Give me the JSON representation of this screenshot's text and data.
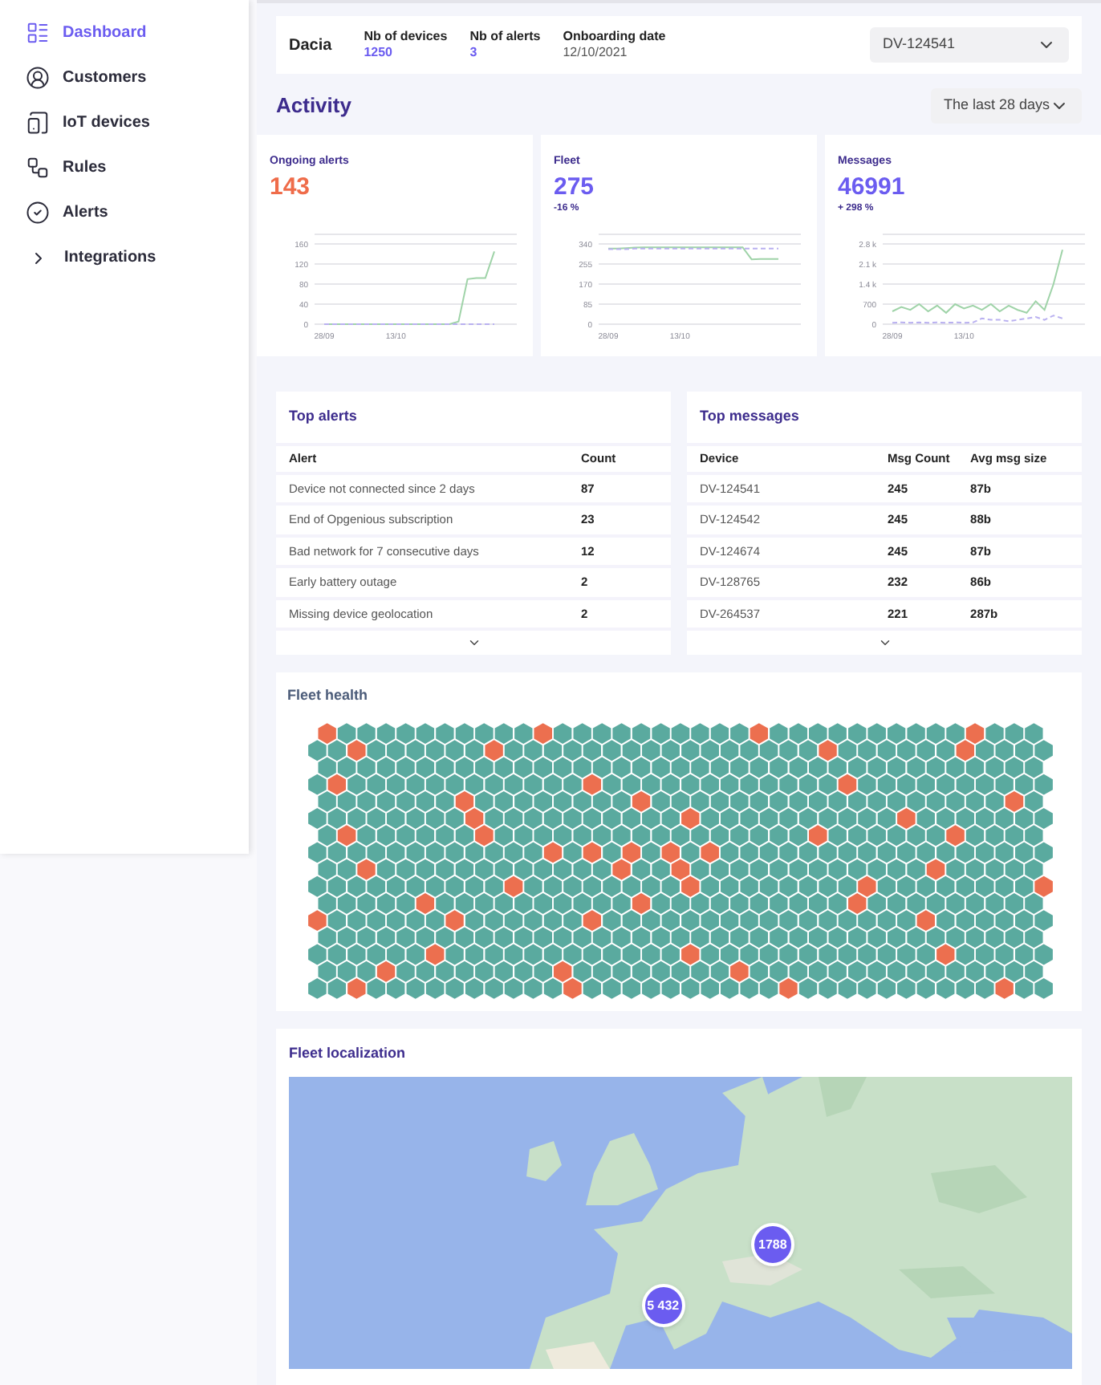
{
  "sidebar": {
    "items": [
      {
        "label": "Dashboard",
        "kind": "link",
        "selected": true
      },
      {
        "label": "Customers",
        "kind": "link",
        "selected": false
      },
      {
        "label": "IoT devices",
        "kind": "link",
        "selected": false
      },
      {
        "label": "Rules",
        "kind": "link",
        "selected": false
      },
      {
        "label": "Alerts",
        "kind": "link",
        "selected": false
      },
      {
        "label": "Integrations",
        "kind": "group",
        "selected": false,
        "expanded": false
      }
    ]
  },
  "customer": {
    "name": "Dacia",
    "facts": [
      {
        "label": "Nb of devices",
        "value": "1250",
        "kind": "highlight"
      },
      {
        "label": "Nb of alerts",
        "value": "3",
        "kind": "highlight"
      },
      {
        "label": "Onboarding date",
        "value": "12/10/2021",
        "kind": "plain"
      }
    ],
    "device_select": {
      "value": "DV-124541"
    }
  },
  "activity": {
    "title": "Activity",
    "period_select": {
      "value": "The last 28 days"
    },
    "cards": [
      {
        "title": "Ongoing alerts",
        "value": "143",
        "color": "#ef6c4a",
        "chart_data": {
          "type": "line",
          "categories": [
            "28/09",
            null,
            null,
            null,
            null,
            null,
            null,
            null,
            "13/10",
            null,
            null,
            null,
            null,
            null,
            null,
            null,
            null,
            null,
            null,
            null
          ],
          "yticks": [
            0,
            40,
            80,
            120,
            160
          ],
          "ylim": [
            0,
            160
          ],
          "grid": true,
          "series": [
            {
              "color": "#9fd3a8",
              "line_style": "solid",
              "values": [
                0,
                0,
                0,
                0,
                0,
                0,
                0,
                0,
                0,
                0,
                0,
                0,
                0,
                0,
                0,
                5,
                90,
                92,
                92,
                145
              ]
            },
            {
              "color": "#b9b0f0",
              "line_style": "dashed",
              "values": [
                0,
                0,
                0,
                0,
                0,
                0,
                0,
                0,
                0,
                0,
                0,
                0,
                0,
                0,
                0,
                0,
                0,
                0,
                0,
                0
              ]
            }
          ]
        }
      },
      {
        "title": "Fleet",
        "value": "275",
        "change": "-16 %",
        "color": "#6b5cf0",
        "chart_data": {
          "type": "line",
          "categories": [
            "28/09",
            null,
            null,
            null,
            null,
            null,
            null,
            null,
            "13/10",
            null,
            null,
            null,
            null,
            null,
            null,
            null,
            null,
            null,
            null,
            null
          ],
          "yticks": [
            0,
            85,
            170,
            255,
            340
          ],
          "ylim": [
            0,
            340
          ],
          "grid": true,
          "series": [
            {
              "color": "#9fd3a8",
              "line_style": "solid",
              "values": [
                320,
                320,
                322,
                325,
                326,
                326,
                326,
                326,
                326,
                326,
                326,
                326,
                326,
                326,
                326,
                326,
                275,
                276,
                276,
                276
              ]
            },
            {
              "color": "#b9b0f0",
              "line_style": "dashed",
              "values": [
                318,
                318,
                318,
                320,
                320,
                320,
                320,
                320,
                320,
                320,
                320,
                320,
                320,
                320,
                320,
                320,
                320,
                320,
                320,
                320
              ]
            }
          ]
        }
      },
      {
        "title": "Messages",
        "value": "46991",
        "change": "+ 298 %",
        "color": "#6b5cf0",
        "chart_data": {
          "type": "line",
          "categories": [
            "28/09",
            null,
            null,
            null,
            null,
            null,
            null,
            null,
            "13/10",
            null,
            null,
            null,
            null,
            null,
            null,
            null,
            null,
            null,
            null,
            null
          ],
          "yticks": [
            {
              "value": 0,
              "label": "0"
            },
            {
              "value": 700,
              "label": "700"
            },
            {
              "value": 1400,
              "label": "1.4 k"
            },
            {
              "value": 2100,
              "label": "2.1 k"
            },
            {
              "value": 2800,
              "label": "2.8 k"
            }
          ],
          "ylim": [
            0,
            2800
          ],
          "grid": true,
          "series": [
            {
              "color": "#9fd3a8",
              "line_style": "solid",
              "values": [
                450,
                600,
                500,
                700,
                450,
                650,
                400,
                700,
                550,
                650,
                500,
                700,
                450,
                650,
                500,
                400,
                800,
                500,
                1400,
                2600
              ]
            },
            {
              "color": "#b9b0f0",
              "line_style": "dashed",
              "values": [
                50,
                60,
                50,
                60,
                50,
                60,
                50,
                60,
                50,
                60,
                200,
                150,
                150,
                100,
                150,
                200,
                250,
                150,
                300,
                200
              ]
            }
          ]
        }
      }
    ]
  },
  "top_alerts": {
    "title": "Top alerts",
    "columns": [
      "Alert",
      "Count"
    ],
    "rows": [
      [
        "Device not connected since 2 days",
        "87"
      ],
      [
        "End of Opgenious subscription",
        "23"
      ],
      [
        "Bad network for 7 consecutive days",
        "12"
      ],
      [
        "Early battery outage",
        "2"
      ],
      [
        "Missing device geolocation",
        "2"
      ]
    ]
  },
  "top_messages": {
    "title": "Top messages",
    "columns": [
      "Device",
      "Msg Count",
      "Avg msg size"
    ],
    "rows": [
      [
        "DV-124541",
        "245",
        "87b"
      ],
      [
        "DV-124542",
        "245",
        "88b"
      ],
      [
        "DV-124674",
        "245",
        "87b"
      ],
      [
        "DV-128765",
        "232",
        "86b"
      ],
      [
        "DV-264537",
        "221",
        "287b"
      ]
    ]
  },
  "fleet_health": {
    "title": "Fleet health"
  },
  "fleet_localization": {
    "title": "Fleet localization",
    "map": {
      "kind": "picture",
      "clusters": [
        {
          "count": "1788",
          "kind": "cluster"
        },
        {
          "count": "5 432",
          "kind": "cluster"
        }
      ]
    }
  }
}
